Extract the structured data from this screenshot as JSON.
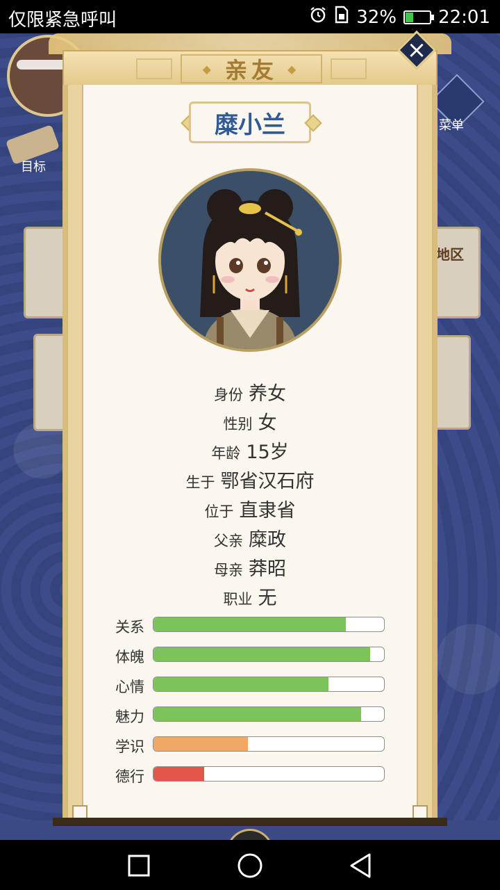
{
  "status_bar": {
    "carrier_text": "仅限紧急呼叫",
    "battery_percent": "32%",
    "battery_level": 0.32,
    "time": "22:01",
    "icons": [
      "alarm-icon",
      "sim-card-icon",
      "battery-charging-icon"
    ]
  },
  "background": {
    "goal_label": "目标",
    "menu_label": "菜单",
    "region_label": "地区"
  },
  "dialog": {
    "title": "亲友",
    "name": "糜小兰",
    "info": [
      {
        "label": "身份",
        "value": "养女"
      },
      {
        "label": "性别",
        "value": "女"
      },
      {
        "label": "年龄",
        "value": "15岁"
      },
      {
        "label": "生于",
        "value": "鄂省汉石府"
      },
      {
        "label": "位于",
        "value": "直隶省"
      },
      {
        "label": "父亲",
        "value": "糜政"
      },
      {
        "label": "母亲",
        "value": "莽昭"
      },
      {
        "label": "职业",
        "value": "无"
      }
    ],
    "stats": [
      {
        "label": "关系",
        "level": 0.835,
        "color": "#7cc35a"
      },
      {
        "label": "体魄",
        "level": 0.94,
        "color": "#7cc35a"
      },
      {
        "label": "心情",
        "level": 0.76,
        "color": "#7cc35a"
      },
      {
        "label": "魅力",
        "level": 0.9,
        "color": "#7cc35a"
      },
      {
        "label": "学识",
        "level": 0.41,
        "color": "#f0a867"
      },
      {
        "label": "德行",
        "level": 0.22,
        "color": "#e2574a"
      }
    ]
  },
  "nav": {
    "icons": [
      "recent-apps-icon",
      "home-icon",
      "back-icon"
    ]
  }
}
